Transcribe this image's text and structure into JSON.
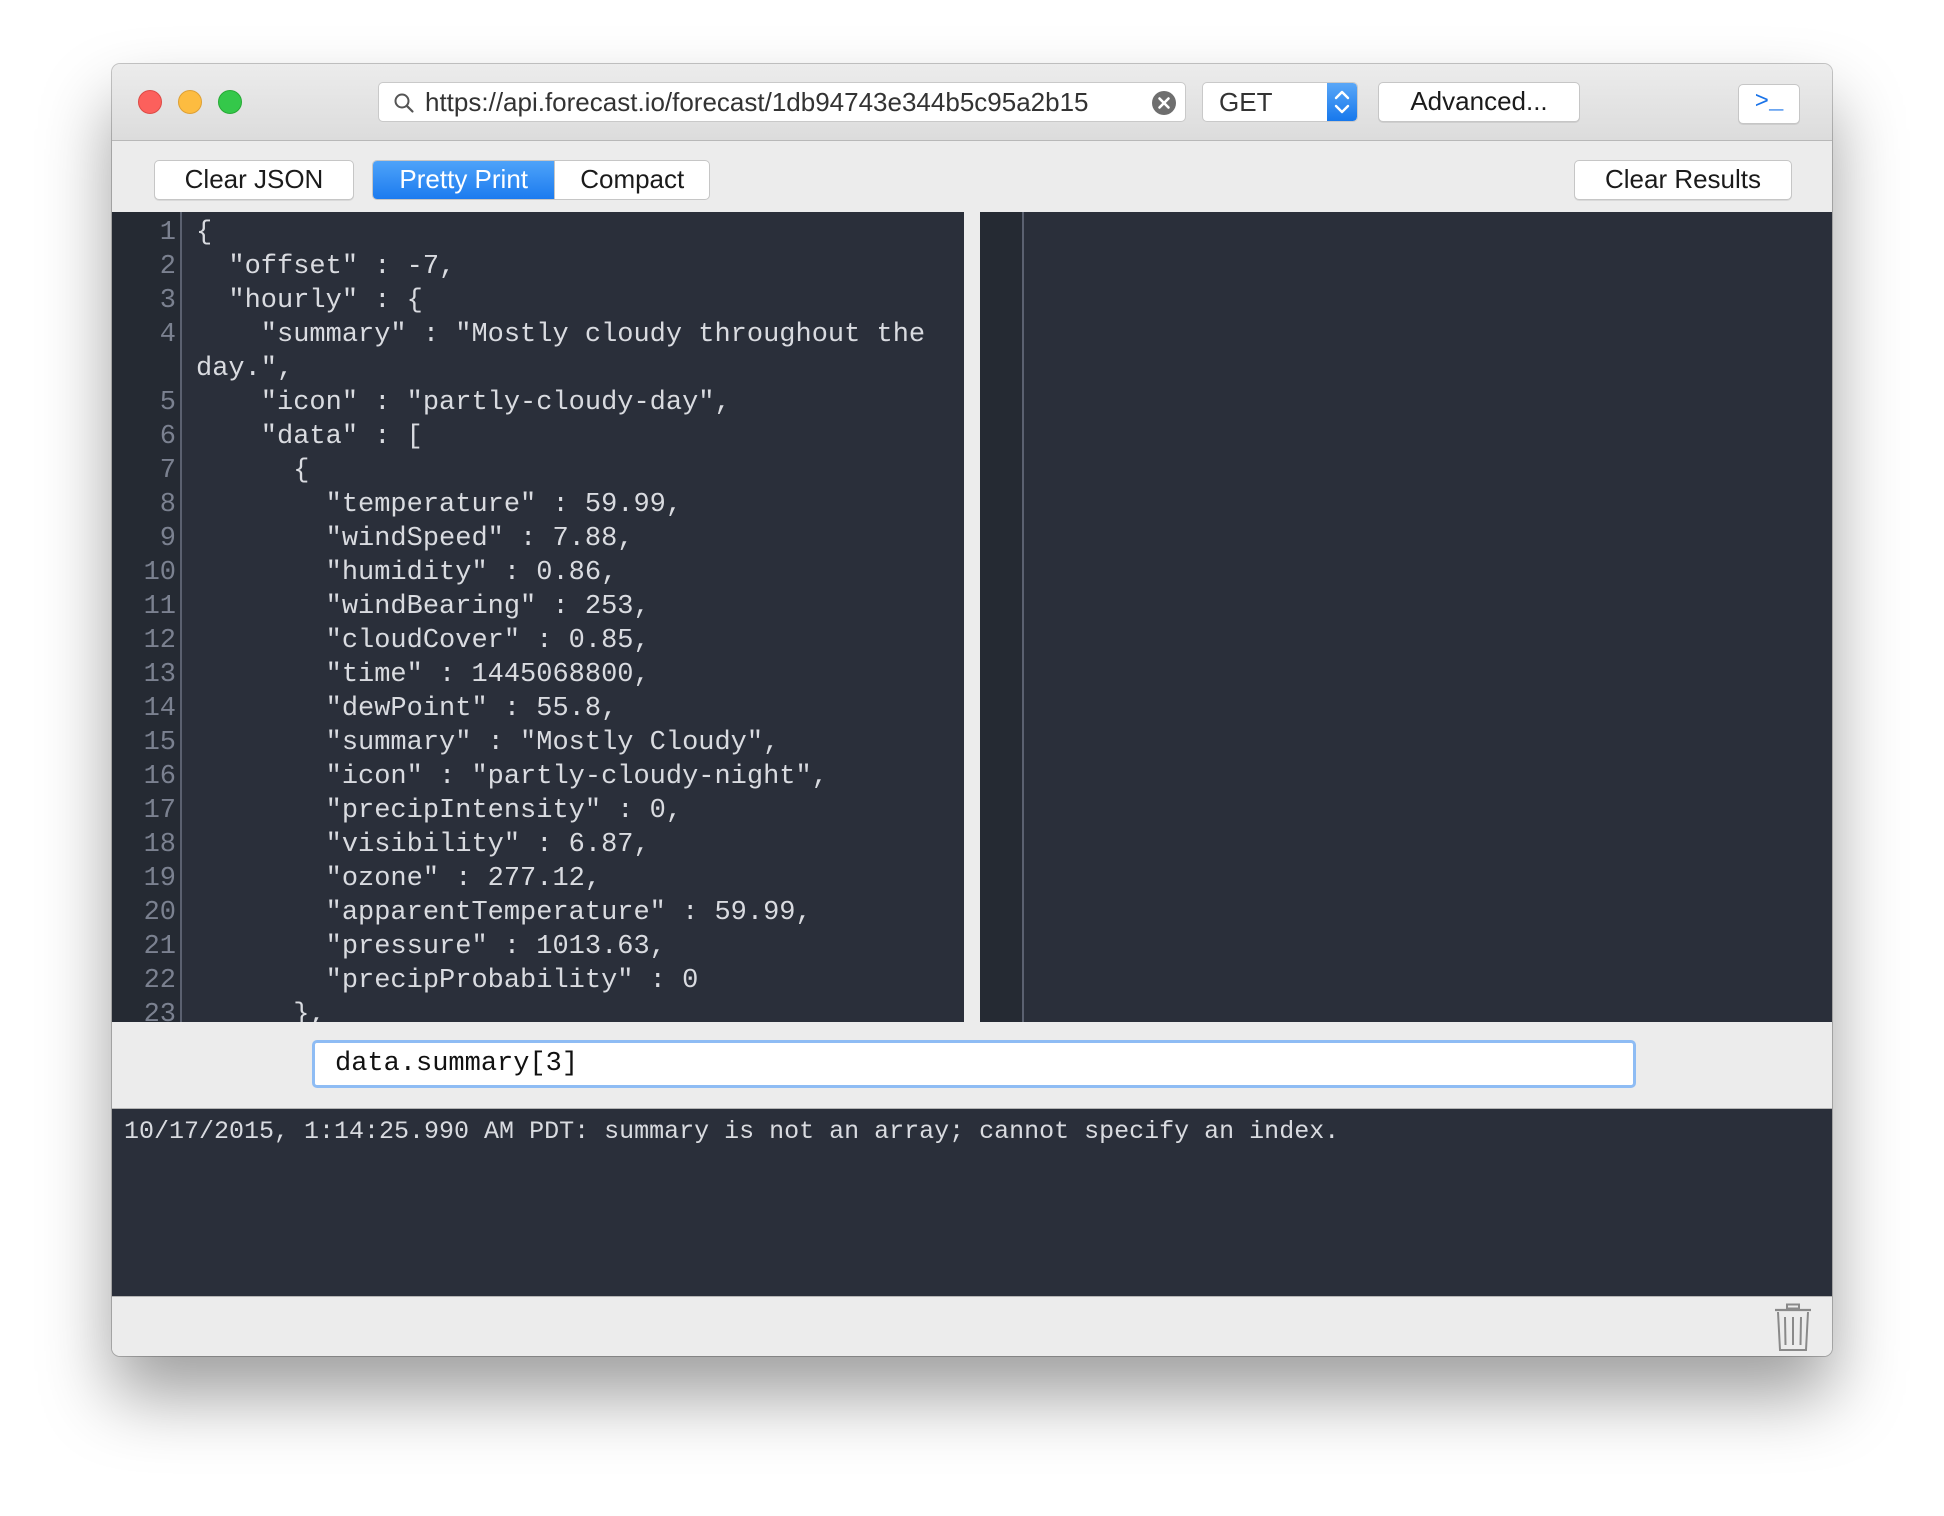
{
  "window": {
    "controls": {
      "close": "close-button",
      "minimize": "minimize-button",
      "zoom": "zoom-button"
    }
  },
  "toolbar_top": {
    "url": "https://api.forecast.io/forecast/1db94743e344b5c95a2b15",
    "method": "GET",
    "advanced_label": "Advanced...",
    "terminal_label": ">_"
  },
  "toolbar": {
    "clear_json_label": "Clear JSON",
    "pretty_print_label": "Pretty Print",
    "compact_label": "Compact",
    "clear_results_label": "Clear Results",
    "selected_format": "Pretty Print"
  },
  "editor": {
    "line_numbers": "1\n2\n3\n4\n\n5\n6\n7\n8\n9\n10\n11\n12\n13\n14\n15\n16\n17\n18\n19\n20\n21\n22\n23",
    "code": "{\n  \"offset\" : -7,\n  \"hourly\" : {\n    \"summary\" : \"Mostly cloudy throughout the\nday.\",\n    \"icon\" : \"partly-cloudy-day\",\n    \"data\" : [\n      {\n        \"temperature\" : 59.99,\n        \"windSpeed\" : 7.88,\n        \"humidity\" : 0.86,\n        \"windBearing\" : 253,\n        \"cloudCover\" : 0.85,\n        \"time\" : 1445068800,\n        \"dewPoint\" : 55.8,\n        \"summary\" : \"Mostly Cloudy\",\n        \"icon\" : \"partly-cloudy-night\",\n        \"precipIntensity\" : 0,\n        \"visibility\" : 6.87,\n        \"ozone\" : 277.12,\n        \"apparentTemperature\" : 59.99,\n        \"pressure\" : 1013.63,\n        \"precipProbability\" : 0\n      },"
  },
  "query": {
    "value": "data.summary[3]"
  },
  "log": {
    "lines": [
      "10/17/2015, 1:14:25.990 AM PDT: summary is not an array; cannot specify an index."
    ]
  },
  "icons": {
    "search": "search-icon",
    "clear": "clear-icon",
    "stepper": "chevron-updown-icon",
    "trash": "trash-icon"
  },
  "colors": {
    "accent": "#1c7bef",
    "editor_bg": "#2a2f3a",
    "close": "#fc605c",
    "minimize": "#fdbc40",
    "zoom": "#34c84a"
  }
}
